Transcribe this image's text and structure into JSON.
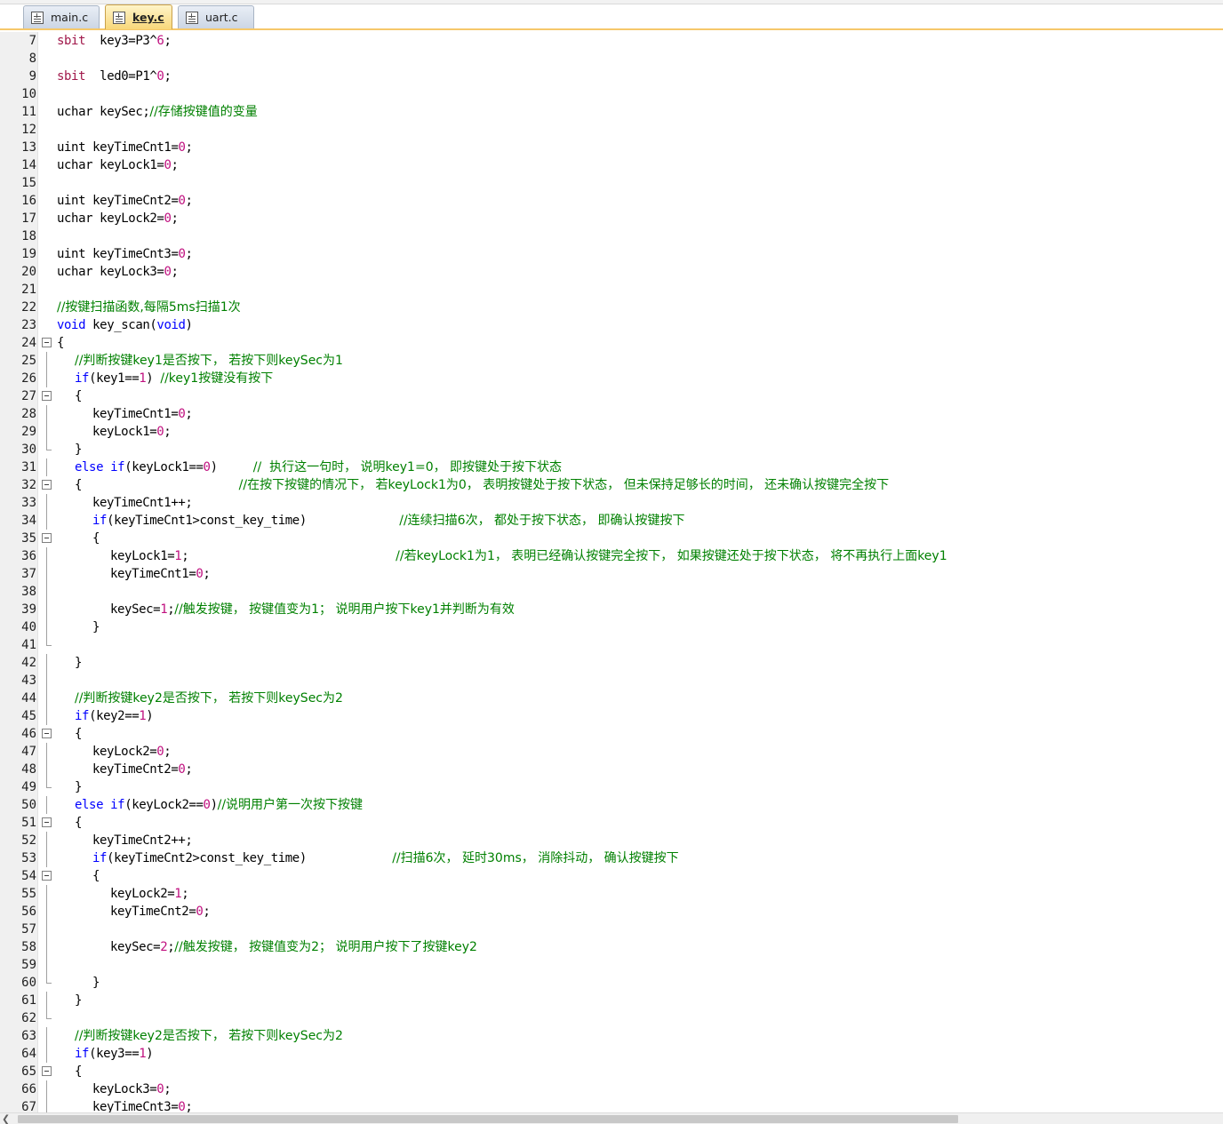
{
  "tabs": [
    {
      "label": "main.c",
      "active": false
    },
    {
      "label": "key.c",
      "active": true
    },
    {
      "label": "uart.c",
      "active": false
    }
  ],
  "lines": [
    {
      "n": "7",
      "fold": "",
      "indent": 0,
      "segs": [
        [
          "kw2",
          "sbit"
        ],
        [
          "",
          "  key3=P3^"
        ],
        [
          "num",
          "6"
        ],
        [
          "",
          ";"
        ]
      ]
    },
    {
      "n": "8",
      "fold": "",
      "indent": 0,
      "segs": []
    },
    {
      "n": "9",
      "fold": "",
      "indent": 0,
      "segs": [
        [
          "kw2",
          "sbit"
        ],
        [
          "",
          "  led0=P1^"
        ],
        [
          "num",
          "0"
        ],
        [
          "",
          ";"
        ]
      ]
    },
    {
      "n": "10",
      "fold": "",
      "indent": 0,
      "segs": []
    },
    {
      "n": "11",
      "fold": "",
      "indent": 0,
      "segs": [
        [
          "",
          "uchar keySec;"
        ],
        [
          "cm",
          "//存储按键值的变量"
        ]
      ]
    },
    {
      "n": "12",
      "fold": "",
      "indent": 0,
      "segs": []
    },
    {
      "n": "13",
      "fold": "",
      "indent": 0,
      "segs": [
        [
          "",
          "uint keyTimeCnt1="
        ],
        [
          "num",
          "0"
        ],
        [
          "",
          ";"
        ]
      ]
    },
    {
      "n": "14",
      "fold": "",
      "indent": 0,
      "segs": [
        [
          "",
          "uchar keyLock1="
        ],
        [
          "num",
          "0"
        ],
        [
          "",
          ";"
        ]
      ]
    },
    {
      "n": "15",
      "fold": "",
      "indent": 0,
      "segs": []
    },
    {
      "n": "16",
      "fold": "",
      "indent": 0,
      "segs": [
        [
          "",
          "uint keyTimeCnt2="
        ],
        [
          "num",
          "0"
        ],
        [
          "",
          ";"
        ]
      ]
    },
    {
      "n": "17",
      "fold": "",
      "indent": 0,
      "segs": [
        [
          "",
          "uchar keyLock2="
        ],
        [
          "num",
          "0"
        ],
        [
          "",
          ";"
        ]
      ]
    },
    {
      "n": "18",
      "fold": "",
      "indent": 0,
      "segs": []
    },
    {
      "n": "19",
      "fold": "",
      "indent": 0,
      "segs": [
        [
          "",
          "uint keyTimeCnt3="
        ],
        [
          "num",
          "0"
        ],
        [
          "",
          ";"
        ]
      ]
    },
    {
      "n": "20",
      "fold": "",
      "indent": 0,
      "segs": [
        [
          "",
          "uchar keyLock3="
        ],
        [
          "num",
          "0"
        ],
        [
          "",
          ";"
        ]
      ]
    },
    {
      "n": "21",
      "fold": "",
      "indent": 0,
      "segs": []
    },
    {
      "n": "22",
      "fold": "",
      "indent": 0,
      "segs": [
        [
          "cm",
          "//按键扫描函数,每隔5ms扫描1次"
        ]
      ]
    },
    {
      "n": "23",
      "fold": "",
      "indent": 0,
      "segs": [
        [
          "kw",
          "void"
        ],
        [
          "",
          " key_scan("
        ],
        [
          "kw",
          "void"
        ],
        [
          "",
          ")"
        ]
      ]
    },
    {
      "n": "24",
      "fold": "box",
      "indent": 0,
      "segs": [
        [
          "",
          "{"
        ]
      ]
    },
    {
      "n": "25",
      "fold": "bar",
      "indent": 1,
      "segs": [
        [
          "cm",
          "//判断按键key1是否按下， 若按下则keySec为1"
        ]
      ]
    },
    {
      "n": "26",
      "fold": "bar",
      "indent": 1,
      "segs": [
        [
          "kw",
          "if"
        ],
        [
          "",
          "(key1=="
        ],
        [
          "num",
          "1"
        ],
        [
          "",
          ") "
        ],
        [
          "cm",
          "//key1按键没有按下"
        ]
      ]
    },
    {
      "n": "27",
      "fold": "box",
      "indent": 1,
      "segs": [
        [
          "",
          "{"
        ]
      ]
    },
    {
      "n": "28",
      "fold": "bar",
      "indent": 2,
      "segs": [
        [
          "",
          "keyTimeCnt1="
        ],
        [
          "num",
          "0"
        ],
        [
          "",
          ";"
        ]
      ]
    },
    {
      "n": "29",
      "fold": "bar",
      "indent": 2,
      "segs": [
        [
          "",
          "keyLock1="
        ],
        [
          "num",
          "0"
        ],
        [
          "",
          ";"
        ]
      ]
    },
    {
      "n": "30",
      "fold": "end",
      "indent": 1,
      "segs": [
        [
          "",
          "}"
        ]
      ]
    },
    {
      "n": "31",
      "fold": "bar",
      "indent": 1,
      "segs": [
        [
          "kw",
          "else"
        ],
        [
          "",
          " "
        ],
        [
          "kw",
          "if"
        ],
        [
          "",
          "(keyLock1=="
        ],
        [
          "num",
          "0"
        ],
        [
          "",
          ")     "
        ],
        [
          "cm",
          "//  执行这一句时， 说明key1=0， 即按键处于按下状态"
        ]
      ]
    },
    {
      "n": "32",
      "fold": "box",
      "indent": 1,
      "segs": [
        [
          "",
          "{                      "
        ],
        [
          "cm",
          "//在按下按键的情况下， 若keyLock1为0， 表明按键处于按下状态， 但未保持足够长的时间， 还未确认按键完全按下"
        ]
      ]
    },
    {
      "n": "33",
      "fold": "bar",
      "indent": 2,
      "segs": [
        [
          "",
          "keyTimeCnt1++;"
        ]
      ]
    },
    {
      "n": "34",
      "fold": "bar",
      "indent": 2,
      "segs": [
        [
          "kw",
          "if"
        ],
        [
          "",
          "(keyTimeCnt1>const_key_time)             "
        ],
        [
          "cm",
          "//连续扫描6次， 都处于按下状态， 即确认按键按下"
        ]
      ]
    },
    {
      "n": "35",
      "fold": "box",
      "indent": 2,
      "segs": [
        [
          "",
          "{"
        ]
      ]
    },
    {
      "n": "36",
      "fold": "bar",
      "indent": 3,
      "segs": [
        [
          "",
          "keyLock1="
        ],
        [
          "num",
          "1"
        ],
        [
          "",
          ";                             "
        ],
        [
          "cm",
          "//若keyLock1为1， 表明已经确认按键完全按下， 如果按键还处于按下状态， 将不再执行上面key1"
        ]
      ]
    },
    {
      "n": "37",
      "fold": "bar",
      "indent": 3,
      "segs": [
        [
          "",
          "keyTimeCnt1="
        ],
        [
          "num",
          "0"
        ],
        [
          "",
          ";"
        ]
      ]
    },
    {
      "n": "38",
      "fold": "bar",
      "indent": 3,
      "segs": []
    },
    {
      "n": "39",
      "fold": "bar",
      "indent": 3,
      "segs": [
        [
          "",
          "keySec="
        ],
        [
          "num",
          "1"
        ],
        [
          "",
          ";"
        ],
        [
          "cm",
          "//触发按键， 按键值变为1； 说明用户按下key1并判断为有效"
        ]
      ]
    },
    {
      "n": "40",
      "fold": "bar",
      "indent": 2,
      "segs": [
        [
          "",
          "}"
        ]
      ]
    },
    {
      "n": "41",
      "fold": "end",
      "indent": 0,
      "segs": []
    },
    {
      "n": "42",
      "fold": "bar",
      "indent": 1,
      "segs": [
        [
          "",
          "}"
        ]
      ]
    },
    {
      "n": "43",
      "fold": "bar",
      "indent": 0,
      "segs": []
    },
    {
      "n": "44",
      "fold": "bar",
      "indent": 1,
      "segs": [
        [
          "cm",
          "//判断按键key2是否按下， 若按下则keySec为2"
        ]
      ]
    },
    {
      "n": "45",
      "fold": "bar",
      "indent": 1,
      "segs": [
        [
          "kw",
          "if"
        ],
        [
          "",
          "(key2=="
        ],
        [
          "num",
          "1"
        ],
        [
          "",
          ")"
        ]
      ]
    },
    {
      "n": "46",
      "fold": "box",
      "indent": 1,
      "segs": [
        [
          "",
          "{"
        ]
      ]
    },
    {
      "n": "47",
      "fold": "bar",
      "indent": 2,
      "segs": [
        [
          "",
          "keyLock2="
        ],
        [
          "num",
          "0"
        ],
        [
          "",
          ";"
        ]
      ]
    },
    {
      "n": "48",
      "fold": "bar",
      "indent": 2,
      "segs": [
        [
          "",
          "keyTimeCnt2="
        ],
        [
          "num",
          "0"
        ],
        [
          "",
          ";"
        ]
      ]
    },
    {
      "n": "49",
      "fold": "end",
      "indent": 1,
      "segs": [
        [
          "",
          "}"
        ]
      ]
    },
    {
      "n": "50",
      "fold": "bar",
      "indent": 1,
      "segs": [
        [
          "kw",
          "else"
        ],
        [
          "",
          " "
        ],
        [
          "kw",
          "if"
        ],
        [
          "",
          "(keyLock2=="
        ],
        [
          "num",
          "0"
        ],
        [
          "",
          ")"
        ],
        [
          "cm",
          "//说明用户第一次按下按键"
        ]
      ]
    },
    {
      "n": "51",
      "fold": "box",
      "indent": 1,
      "segs": [
        [
          "",
          "{"
        ]
      ]
    },
    {
      "n": "52",
      "fold": "bar",
      "indent": 2,
      "segs": [
        [
          "",
          "keyTimeCnt2++;"
        ]
      ]
    },
    {
      "n": "53",
      "fold": "bar",
      "indent": 2,
      "segs": [
        [
          "kw",
          "if"
        ],
        [
          "",
          "(keyTimeCnt2>const_key_time)            "
        ],
        [
          "cm",
          "//扫描6次， 延时30ms， 消除抖动， 确认按键按下"
        ]
      ]
    },
    {
      "n": "54",
      "fold": "box",
      "indent": 2,
      "segs": [
        [
          "",
          "{"
        ]
      ]
    },
    {
      "n": "55",
      "fold": "bar",
      "indent": 3,
      "segs": [
        [
          "",
          "keyLock2="
        ],
        [
          "num",
          "1"
        ],
        [
          "",
          ";"
        ]
      ]
    },
    {
      "n": "56",
      "fold": "bar",
      "indent": 3,
      "segs": [
        [
          "",
          "keyTimeCnt2="
        ],
        [
          "num",
          "0"
        ],
        [
          "",
          ";"
        ]
      ]
    },
    {
      "n": "57",
      "fold": "bar",
      "indent": 3,
      "segs": []
    },
    {
      "n": "58",
      "fold": "bar",
      "indent": 3,
      "segs": [
        [
          "",
          "keySec="
        ],
        [
          "num",
          "2"
        ],
        [
          "",
          ";"
        ],
        [
          "cm",
          "//触发按键， 按键值变为2； 说明用户按下了按键key2"
        ]
      ]
    },
    {
      "n": "59",
      "fold": "bar",
      "indent": 3,
      "segs": []
    },
    {
      "n": "60",
      "fold": "end",
      "indent": 2,
      "segs": [
        [
          "",
          "}"
        ]
      ]
    },
    {
      "n": "61",
      "fold": "bar",
      "indent": 1,
      "segs": [
        [
          "",
          "}"
        ]
      ]
    },
    {
      "n": "62",
      "fold": "end",
      "indent": 0,
      "segs": []
    },
    {
      "n": "63",
      "fold": "bar",
      "indent": 1,
      "segs": [
        [
          "cm",
          "//判断按键key2是否按下， 若按下则keySec为2"
        ]
      ]
    },
    {
      "n": "64",
      "fold": "bar",
      "indent": 1,
      "segs": [
        [
          "kw",
          "if"
        ],
        [
          "",
          "(key3=="
        ],
        [
          "num",
          "1"
        ],
        [
          "",
          ")"
        ]
      ]
    },
    {
      "n": "65",
      "fold": "box",
      "indent": 1,
      "segs": [
        [
          "",
          "{"
        ]
      ]
    },
    {
      "n": "66",
      "fold": "bar",
      "indent": 2,
      "segs": [
        [
          "",
          "keyLock3="
        ],
        [
          "num",
          "0"
        ],
        [
          "",
          ";"
        ]
      ]
    },
    {
      "n": "67",
      "fold": "bar",
      "indent": 2,
      "segs": [
        [
          "",
          "keyTimeCnt3="
        ],
        [
          "num",
          "0"
        ],
        [
          "",
          ";"
        ]
      ]
    }
  ]
}
